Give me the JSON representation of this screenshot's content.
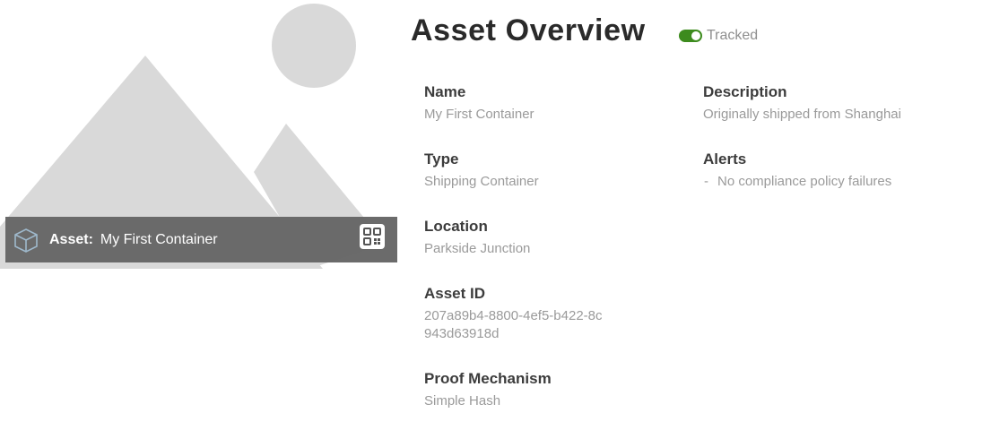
{
  "asset_bar": {
    "label": "Asset:",
    "value": "My First Container",
    "cube_icon": "cube-icon",
    "qr_icon": "qr-code-icon"
  },
  "header": {
    "title": "Asset Overview",
    "tracked_label": "Tracked",
    "tracked_on": true,
    "toggle_color": "#3d8b1e"
  },
  "details": {
    "name": {
      "label": "Name",
      "value": "My First Container"
    },
    "type": {
      "label": "Type",
      "value": "Shipping Container"
    },
    "location": {
      "label": "Location",
      "value": "Parkside Junction"
    },
    "asset_id": {
      "label": "Asset ID",
      "value": "207a89b4-8800-4ef5-b422-8c943d63918d"
    },
    "proof_mechanism": {
      "label": "Proof Mechanism",
      "value": "Simple Hash"
    },
    "description": {
      "label": "Description",
      "value": "Originally shipped from Shanghai"
    },
    "alerts": {
      "label": "Alerts",
      "bullet": "-",
      "value": "No compliance policy failures"
    }
  }
}
